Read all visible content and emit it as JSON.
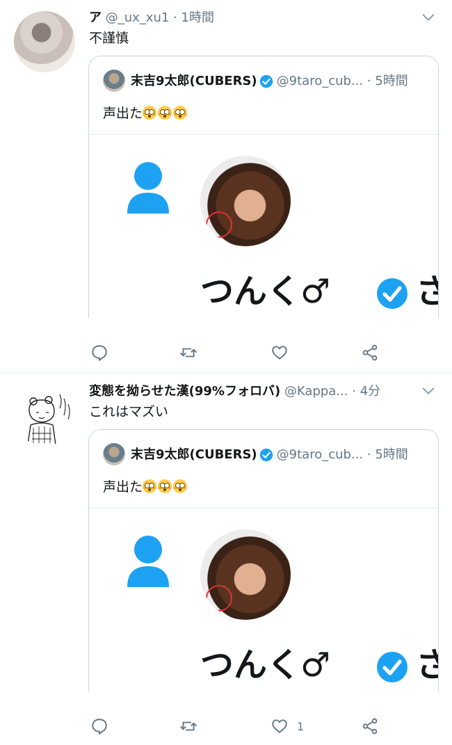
{
  "tweets": [
    {
      "author_name": "ア",
      "handle": "@_ux_xu1",
      "dot": "·",
      "time": "1時間",
      "text": "不謹慎",
      "quote": {
        "name": "末吉9太郎(CUBERS)",
        "handle": "@9taro_cub...",
        "dot": "·",
        "time": "5時間",
        "text": "声出た",
        "image_text": "つんく♂",
        "image_text_cut": "さ"
      },
      "actions": {
        "reply": "",
        "retweet": "",
        "like": "",
        "share": ""
      }
    },
    {
      "author_name": "変態を拗らせた漢(99%フォロバ)",
      "handle": "@Kappa...",
      "dot": "·",
      "time": "4分",
      "text": "これはマズい",
      "quote": {
        "name": "末吉9太郎(CUBERS)",
        "handle": "@9taro_cub...",
        "dot": "·",
        "time": "5時間",
        "text": "声出た",
        "image_text": "つんく♂",
        "image_text_cut": "さ"
      },
      "actions": {
        "reply": "",
        "retweet": "",
        "like": "1",
        "share": ""
      }
    }
  ],
  "colors": {
    "accent": "#1da1f2",
    "muted": "#657786",
    "border": "#ccd6dd",
    "divider": "#e6ecf0"
  },
  "icons": {
    "reply": "speech-bubble-icon",
    "retweet": "retweet-icon",
    "like": "heart-icon",
    "share": "share-icon",
    "more": "chevron-down-icon",
    "verified": "verified-badge-icon"
  }
}
